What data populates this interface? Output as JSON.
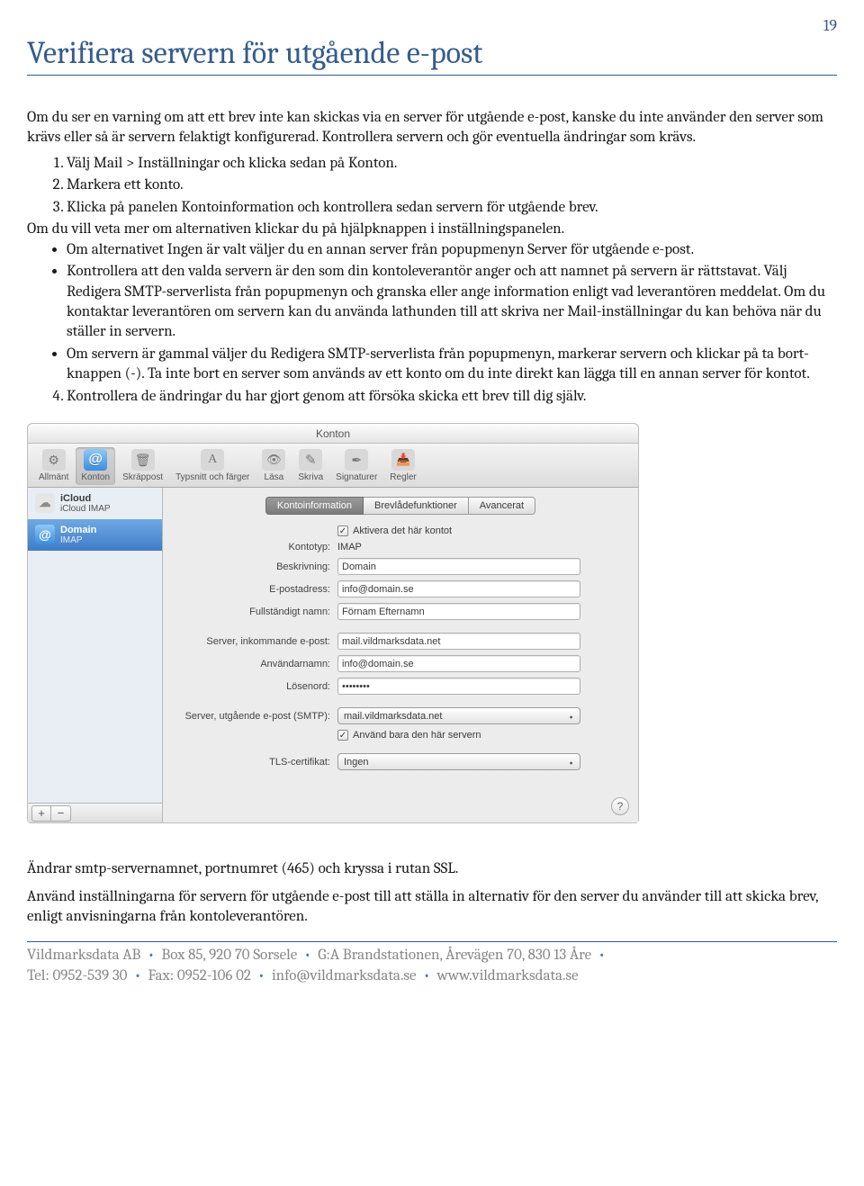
{
  "page_number": "19",
  "title": "Verifiera servern för utgående e-post",
  "intro1": "Om du ser en varning om att ett brev inte kan skickas via en server för utgående e-post, kanske du inte använder den server som krävs eller så är servern felaktigt konfigurerad. Kontrollera servern och gör eventuella ändringar som krävs.",
  "steps": {
    "s1": "Välj Mail > Inställningar och klicka sedan på Konton.",
    "s2": "Markera ett konto.",
    "s3": "Klicka på panelen Kontoinformation och kontrollera sedan servern för utgående brev.",
    "s4": "Kontrollera de ändringar du har gjort genom att försöka skicka ett brev till dig själv."
  },
  "interject": "Om du vill veta mer om alternativen klickar du på hjälpknappen i inställningspanelen.",
  "bullets": {
    "b1": "Om alternativet Ingen är valt väljer du en annan server från popupmenyn Server för utgående e-post.",
    "b2": "Kontrollera att den valda servern är den som din kontoleverantör anger och att namnet på servern är rättstavat. Välj Redigera SMTP-serverlista från popupmenyn och granska eller ange information enligt vad leverantören meddelat.  Om du kontaktar leverantören om servern kan du använda lathunden till att skriva ner Mail-inställningar du kan behöva när du ställer in servern.",
    "b3": "Om servern är gammal väljer du Redigera SMTP-serverlista från popupmenyn, markerar servern och klickar på ta bort-knappen (-). Ta inte bort en server som används av ett konto om du inte direkt kan lägga till en annan server för kontot."
  },
  "prefs": {
    "title": "Konton",
    "toolbar": {
      "general": "Allmänt",
      "accounts": "Konton",
      "junk": "Skräppost",
      "fonts": "Typsnitt och färger",
      "read": "Läsa",
      "write": "Skriva",
      "signatures": "Signaturer",
      "rules": "Regler"
    },
    "accounts": {
      "icloud_title": "iCloud",
      "icloud_sub": "iCloud IMAP",
      "domain_title": "Domain",
      "domain_sub": "IMAP"
    },
    "seg": {
      "info": "Kontoinformation",
      "mailbox": "Brevlådefunktioner",
      "advanced": "Avancerat"
    },
    "fields": {
      "activate_label": "Aktivera det här kontot",
      "type_label": "Kontotyp:",
      "type_value": "IMAP",
      "desc_label": "Beskrivning:",
      "desc_value": "Domain",
      "email_label": "E-postadress:",
      "email_value": "info@domain.se",
      "fullname_label": "Fullständigt namn:",
      "fullname_value": "Förnam Efternamn",
      "incoming_label": "Server, inkommande e-post:",
      "incoming_value": "mail.vildmarksdata.net",
      "user_label": "Användarnamn:",
      "user_value": "info@domain.se",
      "pass_label": "Lösenord:",
      "pass_value": "••••••••",
      "smtp_label": "Server, utgående e-post (SMTP):",
      "smtp_value": "mail.vildmarksdata.net",
      "onlythis_label": "Använd bara den här servern",
      "tls_label": "TLS-certifikat:",
      "tls_value": "Ingen"
    }
  },
  "after1": "Ändrar smtp-servernamnet, portnumret (465) och kryssa i rutan SSL.",
  "after2": "Använd inställningarna för servern för utgående e-post till att ställa in alternativ för den server du använder till att skicka brev, enligt anvisningarna från kontoleverantören.",
  "footer": {
    "line1a": "Vildmarksdata AB",
    "line1b": "Box 85, 920 70 Sorsele",
    "line1c": "G:A Brandstationen, Årevägen 70, 830 13 Åre",
    "line2a": "Tel: 0952-539 30",
    "line2b": "Fax: 0952-106 02",
    "line2c": "info@vildmarksdata.se",
    "line2d": "www.vildmarksdata.se"
  }
}
